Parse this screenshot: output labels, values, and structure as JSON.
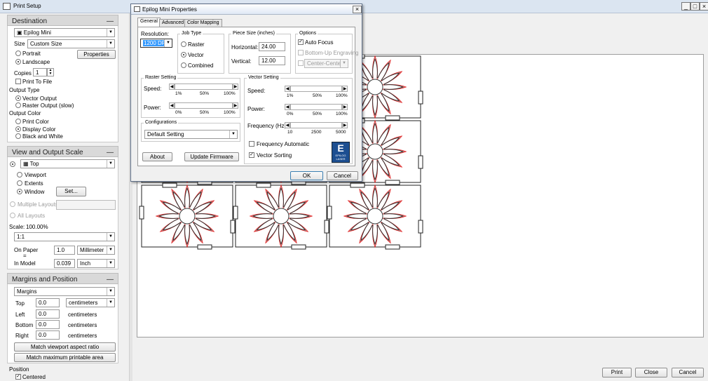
{
  "window": {
    "title": "Print Setup",
    "min": "_",
    "max": "□",
    "close": "×"
  },
  "destination": {
    "heading": "Destination",
    "printer": "Epilog Mini",
    "size_label": "Size",
    "size_value": "Custom Size",
    "properties": "Properties",
    "portrait": "Portrait",
    "landscape": "Landscape",
    "copies_label": "Copies",
    "copies_value": "1",
    "print_to_file": "Print To File",
    "output_type_label": "Output Type",
    "vector_output": "Vector Output",
    "raster_output": "Raster Output (slow)",
    "output_color_label": "Output Color",
    "print_color": "Print Color",
    "display_color": "Display Color",
    "black_white": "Black and White"
  },
  "view": {
    "heading": "View and Output Scale",
    "view_value": "Top",
    "viewport": "Viewport",
    "extents": "Extents",
    "window": "Window",
    "set": "Set...",
    "multiple_layouts": "Multiple Layouts",
    "all_layouts": "All Layouts",
    "scale_label": "Scale:",
    "scale_value": "100.00%",
    "ratio_value": "1:1",
    "on_paper_label": "On Paper",
    "on_paper_value": "1.0",
    "on_paper_unit": "Millimeter",
    "equals": "=",
    "in_model_label": "In Model",
    "in_model_value": "0.039",
    "in_model_unit": "Inch"
  },
  "margins": {
    "heading": "Margins and Position",
    "mode": "Margins",
    "top_label": "Top",
    "top_value": "0.0",
    "top_unit": "centimeters",
    "left_label": "Left",
    "left_value": "0.0",
    "left_unit": "centimeters",
    "bottom_label": "Bottom",
    "bottom_value": "0.0",
    "bottom_unit": "centimeters",
    "right_label": "Right",
    "right_value": "0.0",
    "right_unit": "centimeters",
    "match_viewport": "Match viewport aspect ratio",
    "match_printable": "Match maximum printable area",
    "position_label": "Position",
    "centered": "Centered"
  },
  "footer": {
    "print": "Print",
    "close": "Close",
    "cancel": "Cancel"
  },
  "dialog": {
    "title": "Epilog Mini Properties",
    "close": "×",
    "tabs": [
      "General",
      "Advanced",
      "Color Mapping"
    ],
    "resolution_label": "Resolution:",
    "resolution_value": "1200 DPI",
    "job_type_label": "Job Type",
    "raster": "Raster",
    "vector": "Vector",
    "combined": "Combined",
    "piece_size_label": "Piece Size (inches)",
    "horizontal_label": "Horizontal:",
    "horizontal_value": "24.00",
    "vertical_label": "Vertical:",
    "vertical_value": "12.00",
    "options_label": "Options",
    "auto_focus": "Auto Focus",
    "bottom_up": "Bottom-Up Engraving",
    "center": "Center-Center",
    "raster_setting_label": "Raster Setting",
    "speed_label": "Speed:",
    "power_label": "Power:",
    "r_speed_ticks": [
      "1%",
      "50%",
      "100%"
    ],
    "r_power_ticks": [
      "0%",
      "50%",
      "100%"
    ],
    "vector_setting_label": "Vector Setting",
    "v_speed_ticks": [
      "1%",
      "50%",
      "100%"
    ],
    "v_power_ticks": [
      "0%",
      "50%",
      "100%"
    ],
    "frequency_label": "Frequency (Hz):",
    "freq_ticks": [
      "10",
      "2500",
      "5000"
    ],
    "frequency_automatic": "Frequency Automatic",
    "vector_sorting": "Vector Sorting",
    "configurations_label": "Configurations",
    "config_value": "Default Setting",
    "about": "About",
    "update_firmware": "Update Firmware",
    "ok": "OK",
    "cancel": "Cancel",
    "logo_letter": "E",
    "logo_text": "EPILOG LASER"
  }
}
